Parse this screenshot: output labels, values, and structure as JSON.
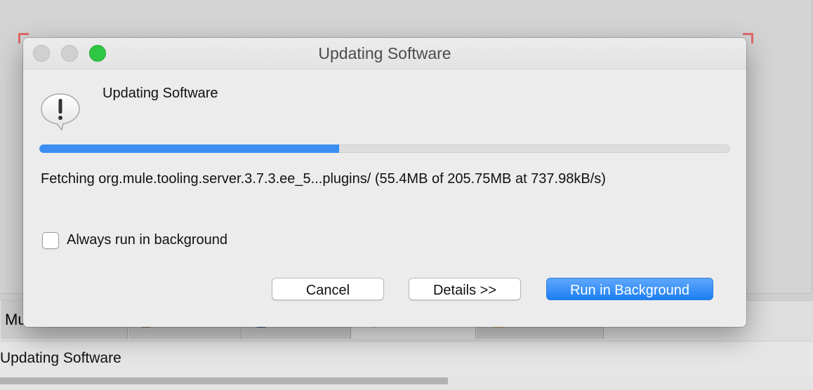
{
  "dialog": {
    "window_title": "Updating Software",
    "heading": "Updating Software",
    "icon": "alert-exclamation-icon",
    "progress": 0.434,
    "status_message": "Fetching org.mule.tooling.server.3.7.3.ee_5...plugins/ (55.4MB of 205.75MB at 737.98kB/s)",
    "always_background": {
      "label": "Always run in background",
      "checked": false
    },
    "buttons": {
      "cancel": "Cancel",
      "details": "Details >>",
      "run_background": "Run in Background"
    },
    "colors": {
      "accent": "#3b8ff3",
      "zoom_button": "#2ec642"
    }
  },
  "background": {
    "tab_visible_text": "Mu",
    "status_text": "Updating Software"
  }
}
